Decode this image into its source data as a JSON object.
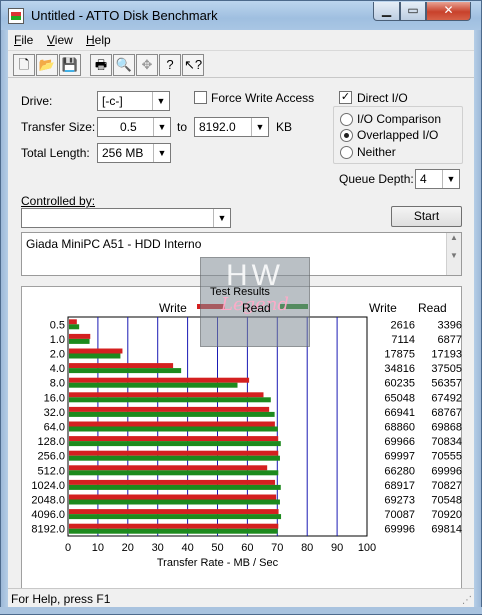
{
  "window": {
    "title": "Untitled - ATTO Disk Benchmark"
  },
  "menu": [
    "File",
    "View",
    "Help"
  ],
  "toolbar_icons": [
    "new-icon",
    "open-icon",
    "save-icon",
    "print-icon",
    "print-preview-icon",
    "move-icon",
    "help-icon",
    "context-help-icon"
  ],
  "form": {
    "drive_label": "Drive:",
    "drive_value": "[-c-]",
    "force_write_label": "Force Write Access",
    "force_write_checked": false,
    "direct_io_label": "Direct I/O",
    "direct_io_checked": true,
    "transfer_size_label": "Transfer Size:",
    "transfer_from": "0.5",
    "to_label": "to",
    "transfer_to": "8192.0",
    "kb_label": "KB",
    "total_length_label": "Total Length:",
    "total_length_value": "256 MB",
    "io_comparison_label": "I/O Comparison",
    "overlapped_io_label": "Overlapped I/O",
    "neither_label": "Neither",
    "selected_mode": "Overlapped I/O",
    "queue_depth_label": "Queue Depth:",
    "queue_depth_value": "4",
    "controlled_by_label": "Controlled by:",
    "controlled_by_value": "",
    "start_label": "Start",
    "description": "Giada MiniPC A51 - HDD Interno"
  },
  "watermark": {
    "top": "HW",
    "bottom": "Legend"
  },
  "chart_data": {
    "type": "bar",
    "orientation": "horizontal",
    "title": "Test Results",
    "xlabel": "Transfer Rate - MB / Sec",
    "xlim": [
      0,
      100
    ],
    "xticks": [
      "0",
      "10",
      "20",
      "30",
      "40",
      "50",
      "60",
      "70",
      "80",
      "90",
      "100"
    ],
    "grid": true,
    "legend_position": "top",
    "categories": [
      "0.5",
      "1.0",
      "2.0",
      "4.0",
      "8.0",
      "16.0",
      "32.0",
      "64.0",
      "128.0",
      "256.0",
      "512.0",
      "1024.0",
      "2048.0",
      "4096.0",
      "8192.0"
    ],
    "series": [
      {
        "name": "Write",
        "color": "#d42020",
        "values": [
          2.616,
          7.114,
          17.875,
          34.816,
          60.235,
          65.048,
          66.941,
          68.86,
          69.966,
          69.997,
          66.28,
          68.917,
          69.273,
          70.087,
          69.996
        ]
      },
      {
        "name": "Read",
        "color": "#1d8a1d",
        "values": [
          3.396,
          6.877,
          17.193,
          37.505,
          56.357,
          67.492,
          68.767,
          69.868,
          70.834,
          70.555,
          69.996,
          70.827,
          70.548,
          70.92,
          69.814
        ]
      }
    ],
    "table": {
      "headers": [
        "Write",
        "Read"
      ],
      "write": [
        "2616",
        "7114",
        "17875",
        "34816",
        "60235",
        "65048",
        "66941",
        "68860",
        "69966",
        "69997",
        "66280",
        "68917",
        "69273",
        "70087",
        "69996"
      ],
      "read": [
        "3396",
        "6877",
        "17193",
        "37505",
        "56357",
        "67492",
        "68767",
        "69868",
        "70834",
        "70555",
        "69996",
        "70827",
        "70548",
        "70920",
        "69814"
      ]
    }
  },
  "status": {
    "text": "For Help, press F1"
  }
}
